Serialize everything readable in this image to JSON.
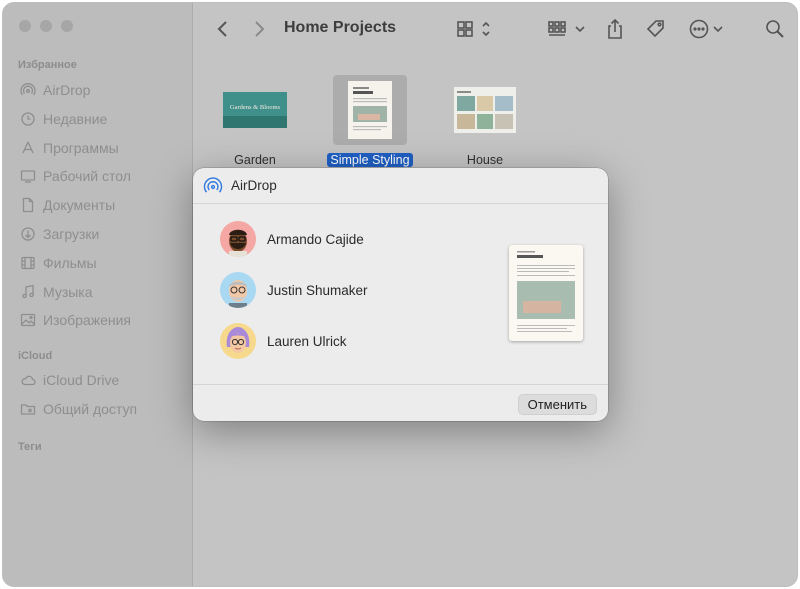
{
  "sidebar": {
    "favorites_header": "Избранное",
    "favorites": [
      {
        "label": "AirDrop",
        "icon": "airdrop-icon"
      },
      {
        "label": "Недавние",
        "icon": "clock-icon"
      },
      {
        "label": "Программы",
        "icon": "apps-icon"
      },
      {
        "label": "Рабочий стол",
        "icon": "desktop-icon"
      },
      {
        "label": "Документы",
        "icon": "document-icon"
      },
      {
        "label": "Загрузки",
        "icon": "download-icon"
      },
      {
        "label": "Фильмы",
        "icon": "film-icon"
      },
      {
        "label": "Музыка",
        "icon": "music-icon"
      },
      {
        "label": "Изображения",
        "icon": "photo-icon"
      }
    ],
    "icloud_header": "iCloud",
    "icloud": [
      {
        "label": "iCloud Drive",
        "icon": "cloud-icon"
      },
      {
        "label": "Общий доступ",
        "icon": "shared-folder-icon"
      }
    ],
    "tags_header": "Теги"
  },
  "toolbar": {
    "title": "Home Projects"
  },
  "files": [
    {
      "name": "Garden",
      "selected": false,
      "thumb_text": "Gardens & Blooms"
    },
    {
      "name": "Simple Styling",
      "selected": true
    },
    {
      "name": "House",
      "selected": false
    }
  ],
  "dialog": {
    "title": "AirDrop",
    "people": [
      {
        "name": "Armando Cajide",
        "avatar_bg": "#f4a7a3"
      },
      {
        "name": "Justin Shumaker",
        "avatar_bg": "#a9d8f2"
      },
      {
        "name": "Lauren Ulrick",
        "avatar_bg": "#f6d98c"
      }
    ],
    "cancel_label": "Отменить"
  },
  "colors": {
    "selection": "#1f5fc4",
    "sidebar_text": "#8e8e8e"
  }
}
